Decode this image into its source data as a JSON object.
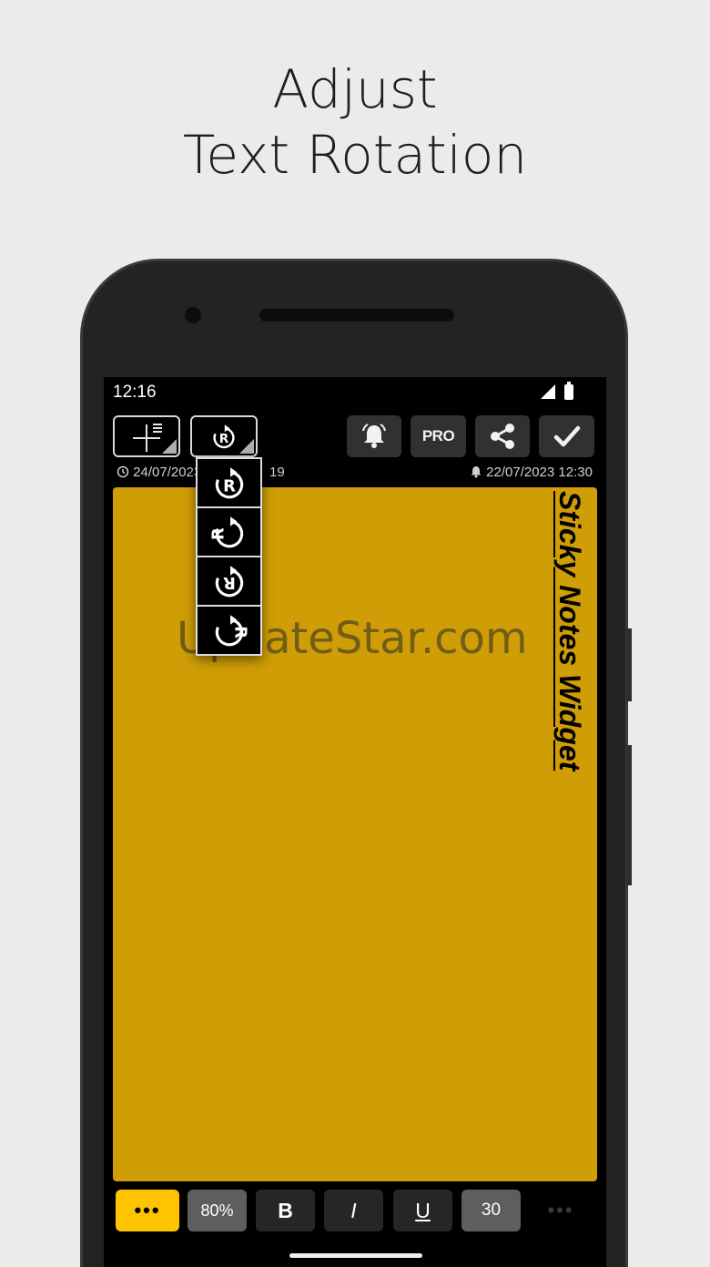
{
  "headline": {
    "line1": "Adjust",
    "line2": "Text Rotation"
  },
  "status_bar": {
    "time": "12:16"
  },
  "toolbar": {
    "pro_label": "PRO"
  },
  "meta": {
    "created": "24/07/2023",
    "created_tail": "19",
    "reminder": "22/07/2023 12:30"
  },
  "note": {
    "text": "Sticky Notes Widget",
    "background": "#cf9d05",
    "watermark": "UpdateStar.com"
  },
  "rotation_menu": {
    "options": [
      "rotation-0",
      "rotation-90",
      "rotation-180",
      "rotation-270"
    ]
  },
  "bottom_bar": {
    "more_label": "•••",
    "opacity_label": "80%",
    "bold_label": "B",
    "italic_label": "I",
    "underline_label": "U",
    "size_label": "30",
    "overflow_label": "•••"
  },
  "colors": {
    "accent": "#ffc400",
    "button": "#313131",
    "note": "#cf9d05"
  }
}
